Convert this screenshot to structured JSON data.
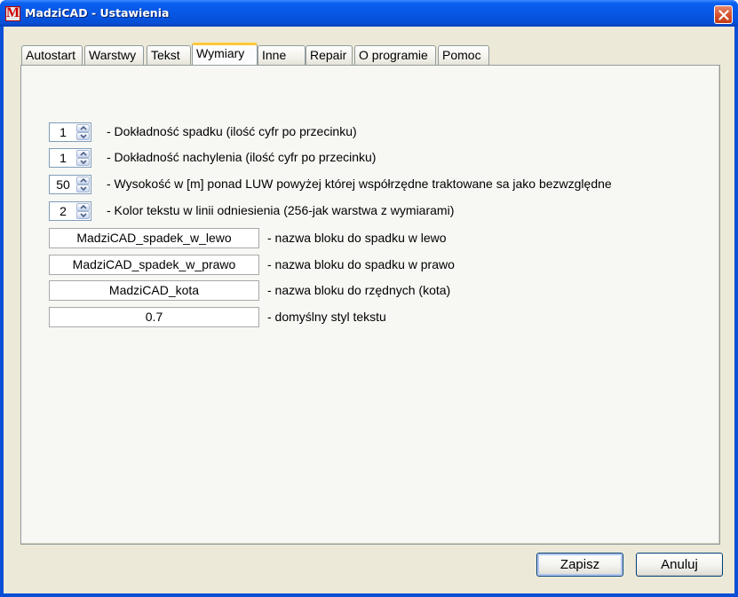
{
  "window": {
    "title": "MadziCAD - Ustawienia",
    "app_icon_glyph": "M"
  },
  "tabs": [
    {
      "label": "Autostart"
    },
    {
      "label": "Warstwy"
    },
    {
      "label": "Tekst"
    },
    {
      "label": "Wymiary"
    },
    {
      "label": "Inne"
    },
    {
      "label": "Repair"
    },
    {
      "label": "O programie"
    },
    {
      "label": "Pomoc"
    }
  ],
  "active_tab": "Wymiary",
  "spinners": [
    {
      "value": "1",
      "label": "- Dokładność spadku (ilość cyfr po przecinku)"
    },
    {
      "value": "1",
      "label": "- Dokładność nachylenia (ilość cyfr po przecinku)"
    },
    {
      "value": "50",
      "label": "- Wysokość w [m] ponad LUW powyżej której współrzędne traktowane sa jako bezwzględne"
    },
    {
      "value": "2",
      "label": "- Kolor tekstu w linii odniesienia (256-jak warstwa z wymiarami)"
    }
  ],
  "fields": [
    {
      "value": "MadziCAD_spadek_w_lewo",
      "label": "- nazwa bloku do spadku w lewo"
    },
    {
      "value": "MadziCAD_spadek_w_prawo",
      "label": "- nazwa bloku do spadku w prawo"
    },
    {
      "value": "MadziCAD_kota",
      "label": "- nazwa bloku do rzędnych (kota)"
    },
    {
      "value": "0.7",
      "label": "- domyślny styl tekstu"
    }
  ],
  "buttons": {
    "save": "Zapisz",
    "cancel": "Anuluj"
  },
  "colors": {
    "titlebar": "#0756e4",
    "close_button": "#d8532e",
    "dialog_background": "#ece9d8",
    "active_tab_accent": "#ffc83c"
  }
}
